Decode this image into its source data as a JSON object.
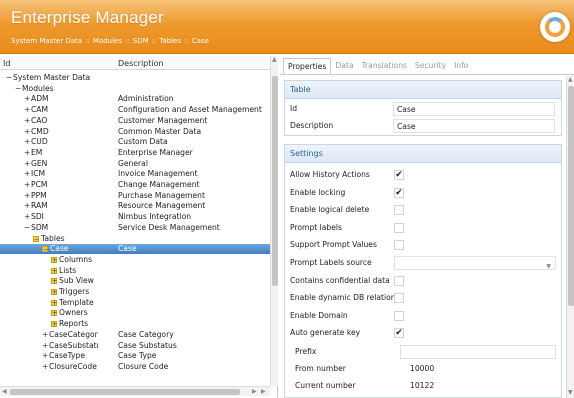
{
  "header": {
    "title": "Enterprise Manager",
    "breadcrumb": [
      "System Master Data",
      "Modules",
      "SDM",
      "Tables",
      "Case"
    ],
    "separator": "::"
  },
  "left": {
    "col_id": "Id",
    "col_desc": "Description",
    "rows": [
      {
        "name": "System Master Data",
        "desc": "",
        "indent": 0,
        "exp": "−",
        "yellow": false
      },
      {
        "name": "Modules",
        "desc": "",
        "indent": 1,
        "exp": "−",
        "yellow": false
      },
      {
        "name": "ADM",
        "desc": "Administration",
        "indent": 2,
        "exp": "+",
        "yellow": false
      },
      {
        "name": "CAM",
        "desc": "Configuration and Asset Management",
        "indent": 2,
        "exp": "+",
        "yellow": false
      },
      {
        "name": "CAO",
        "desc": "Customer Management",
        "indent": 2,
        "exp": "+",
        "yellow": false
      },
      {
        "name": "CMD",
        "desc": "Common Master Data",
        "indent": 2,
        "exp": "+",
        "yellow": false
      },
      {
        "name": "CUD",
        "desc": "Custom Data",
        "indent": 2,
        "exp": "+",
        "yellow": false
      },
      {
        "name": "EM",
        "desc": "Enterprise Manager",
        "indent": 2,
        "exp": "+",
        "yellow": false
      },
      {
        "name": "GEN",
        "desc": "General",
        "indent": 2,
        "exp": "+",
        "yellow": false
      },
      {
        "name": "ICM",
        "desc": "Invoice Management",
        "indent": 2,
        "exp": "+",
        "yellow": false
      },
      {
        "name": "PCM",
        "desc": "Change Management",
        "indent": 2,
        "exp": "+",
        "yellow": false
      },
      {
        "name": "PPM",
        "desc": "Purchase Management",
        "indent": 2,
        "exp": "+",
        "yellow": false
      },
      {
        "name": "RAM",
        "desc": "Resource Management",
        "indent": 2,
        "exp": "+",
        "yellow": false
      },
      {
        "name": "SDI",
        "desc": "Nimbus Integration",
        "indent": 2,
        "exp": "+",
        "yellow": false
      },
      {
        "name": "SDM",
        "desc": "Service Desk Management",
        "indent": 2,
        "exp": "−",
        "yellow": false
      },
      {
        "name": "Tables",
        "desc": "",
        "indent": 3,
        "exp": "−",
        "yellow": true
      },
      {
        "name": "Case",
        "desc": "Case",
        "indent": 4,
        "exp": "−",
        "yellow": true,
        "selected": true
      },
      {
        "name": "Columns",
        "desc": "",
        "indent": 5,
        "exp": "+",
        "yellow": true
      },
      {
        "name": "Lists",
        "desc": "",
        "indent": 5,
        "exp": "+",
        "yellow": true
      },
      {
        "name": "Sub View",
        "desc": "",
        "indent": 5,
        "exp": "+",
        "yellow": true
      },
      {
        "name": "Triggers",
        "desc": "",
        "indent": 5,
        "exp": "+",
        "yellow": true
      },
      {
        "name": "Template",
        "desc": "",
        "indent": 5,
        "exp": "+",
        "yellow": true
      },
      {
        "name": "Owners",
        "desc": "",
        "indent": 5,
        "exp": "+",
        "yellow": true
      },
      {
        "name": "Reports",
        "desc": "",
        "indent": 5,
        "exp": "+",
        "yellow": true
      },
      {
        "name": "CaseCategor",
        "desc": "Case Category",
        "indent": 4,
        "exp": "+",
        "yellow": false
      },
      {
        "name": "CaseSubstatı",
        "desc": "Case Substatus",
        "indent": 4,
        "exp": "+",
        "yellow": false
      },
      {
        "name": "CaseType",
        "desc": "Case Type",
        "indent": 4,
        "exp": "+",
        "yellow": false
      },
      {
        "name": "ClosureCode",
        "desc": "Closure Code",
        "indent": 4,
        "exp": "+",
        "yellow": false
      }
    ]
  },
  "right": {
    "tabs": [
      "Properties",
      "Data",
      "Translations",
      "Security",
      "Info"
    ],
    "table_section": {
      "title": "Table",
      "id_label": "Id",
      "id_value": "Case",
      "desc_label": "Description",
      "desc_value": "Case"
    },
    "settings": {
      "title": "Settings",
      "items": [
        {
          "label": "Allow History Actions",
          "type": "check",
          "checked": true
        },
        {
          "label": "Enable locking",
          "type": "check",
          "checked": true
        },
        {
          "label": "Enable logical delete",
          "type": "check",
          "checked": false
        },
        {
          "label": "Prompt labels",
          "type": "check",
          "checked": false
        },
        {
          "label": "Support Prompt Values",
          "type": "check",
          "checked": false
        },
        {
          "label": "Prompt Labels source",
          "type": "dropdown",
          "value": ""
        },
        {
          "label": "Contains confidential data",
          "type": "check",
          "checked": false
        },
        {
          "label": "Enable dynamic DB relations",
          "type": "check",
          "checked": false
        },
        {
          "label": "Enable Domain",
          "type": "check",
          "checked": false
        },
        {
          "label": "Auto generate key",
          "type": "check",
          "checked": true
        }
      ],
      "sub": [
        {
          "label": "Prefix",
          "value": ""
        },
        {
          "label": "From number",
          "value": "10000"
        },
        {
          "label": "Current number",
          "value": "10122"
        }
      ]
    }
  }
}
